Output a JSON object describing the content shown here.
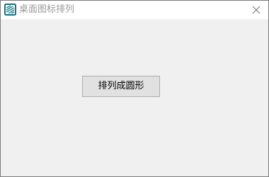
{
  "window": {
    "title": "桌面图标排列",
    "title_color": "#9a9a9a",
    "client_background": "#f0f0f0",
    "app_icon": "teal-stacked-slashes-icon",
    "close_icon": "close-icon"
  },
  "main": {
    "arrange_circle_button_label": "排列成圆形"
  }
}
